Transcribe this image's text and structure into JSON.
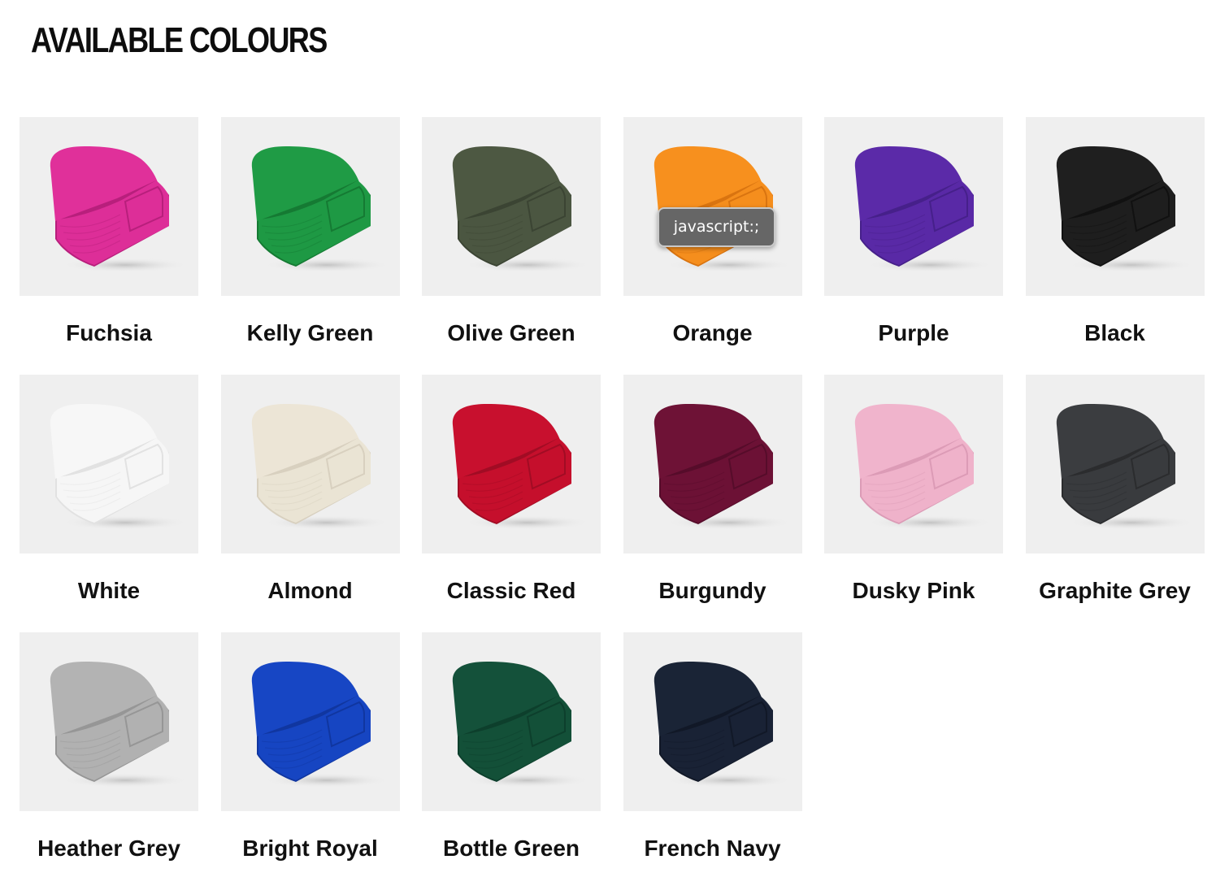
{
  "section": {
    "title": "AVAILABLE COLOURS"
  },
  "colours": [
    {
      "name": "Fuchsia",
      "color": "#e0309a",
      "shade": "#b81f7c",
      "icon": "beanie-image"
    },
    {
      "name": "Kelly Green",
      "color": "#1f9b45",
      "shade": "#157a33",
      "icon": "beanie-image"
    },
    {
      "name": "Olive Green",
      "color": "#4d5842",
      "shade": "#3b4433",
      "icon": "beanie-image"
    },
    {
      "name": "Orange",
      "color": "#f7901e",
      "shade": "#d97410",
      "icon": "beanie-image"
    },
    {
      "name": "Purple",
      "color": "#5b2aa8",
      "shade": "#46208a",
      "icon": "beanie-image"
    },
    {
      "name": "Black",
      "color": "#1f1f1f",
      "shade": "#111111",
      "icon": "beanie-image"
    },
    {
      "name": "White",
      "color": "#f7f7f7",
      "shade": "#e2e2e2",
      "icon": "beanie-image"
    },
    {
      "name": "Almond",
      "color": "#ece5d6",
      "shade": "#d8d0bf",
      "icon": "beanie-image"
    },
    {
      "name": "Classic Red",
      "color": "#c8102e",
      "shade": "#a10c24",
      "icon": "beanie-image"
    },
    {
      "name": "Burgundy",
      "color": "#6e1236",
      "shade": "#560c2a",
      "icon": "beanie-image"
    },
    {
      "name": "Dusky Pink",
      "color": "#f0b4cc",
      "shade": "#dc9bb6",
      "icon": "beanie-image"
    },
    {
      "name": "Graphite Grey",
      "color": "#3b3d40",
      "shade": "#2b2c2e",
      "icon": "beanie-image"
    },
    {
      "name": "Heather Grey",
      "color": "#b3b3b3",
      "shade": "#969696",
      "icon": "beanie-image"
    },
    {
      "name": "Bright Royal",
      "color": "#1746c4",
      "shade": "#1036a0",
      "icon": "beanie-image"
    },
    {
      "name": "Bottle Green",
      "color": "#14513a",
      "shade": "#0d3f2c",
      "icon": "beanie-image"
    },
    {
      "name": "French Navy",
      "color": "#1a2436",
      "shade": "#111827",
      "icon": "beanie-image"
    }
  ],
  "tooltip": {
    "text": "javascript:;"
  }
}
